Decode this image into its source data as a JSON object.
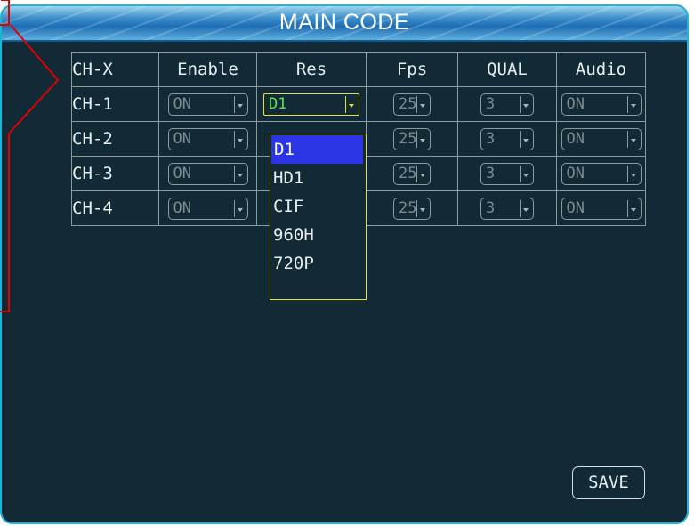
{
  "window": {
    "title": "MAIN CODE"
  },
  "table": {
    "headers": [
      "CH-X",
      "Enable",
      "Res",
      "Fps",
      "QUAL",
      "Audio"
    ],
    "rows": [
      {
        "channel": "CH-1",
        "enable": "ON",
        "res": "D1",
        "fps": "25",
        "qual": "3",
        "audio": "ON"
      },
      {
        "channel": "CH-2",
        "enable": "ON",
        "res": "",
        "fps": "25",
        "qual": "3",
        "audio": "ON"
      },
      {
        "channel": "CH-3",
        "enable": "ON",
        "res": "",
        "fps": "25",
        "qual": "3",
        "audio": "ON"
      },
      {
        "channel": "CH-4",
        "enable": "ON",
        "res": "",
        "fps": "25",
        "qual": "3",
        "audio": "ON"
      }
    ]
  },
  "res_dropdown": {
    "open": true,
    "selected": "D1",
    "options": [
      "D1",
      "HD1",
      "CIF",
      "960H",
      "720P"
    ]
  },
  "buttons": {
    "save": "SAVE"
  },
  "colors": {
    "panel_bg": "#112a36",
    "panel_border": "#1fb5d8",
    "active_border": "#e6e23a",
    "active_value": "#5ee34d",
    "highlight": "#2b35e6",
    "annotation": "#e00000"
  }
}
